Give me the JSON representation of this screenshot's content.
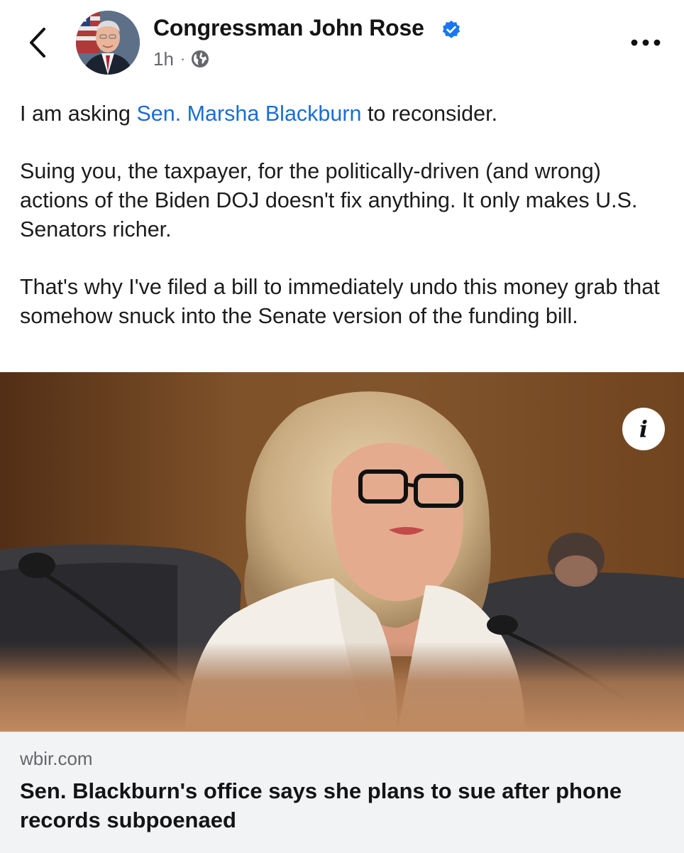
{
  "post": {
    "author": "Congressman John Rose",
    "time": "1h",
    "separator": "·",
    "text": {
      "intro_before": "I am asking ",
      "mention": "Sen. Marsha Blackburn",
      "intro_after": " to reconsider.",
      "paragraph_2": "Suing you, the taxpayer, for the politically-driven (and wrong) actions of the Biden DOJ doesn't fix anything. It only makes U.S. Senators richer.",
      "paragraph_3": "That's why I've filed a bill to immediately undo this money grab that somehow snuck into the Senate version of the funding bill."
    }
  },
  "link_card": {
    "domain": "wbir.com",
    "title": "Sen. Blackburn's office says she plans to sue after phone records subpoenaed",
    "info_glyph": "i"
  },
  "icons": {
    "back": "chevron-left-icon",
    "verified": "verified-badge-icon",
    "audience": "globe-icon",
    "more": "more-options-icon",
    "info": "info-icon"
  },
  "colors": {
    "mention": "#1b6dd4",
    "verified": "#1877f2",
    "meta": "#65676b",
    "card_footer": "#f2f3f5"
  }
}
